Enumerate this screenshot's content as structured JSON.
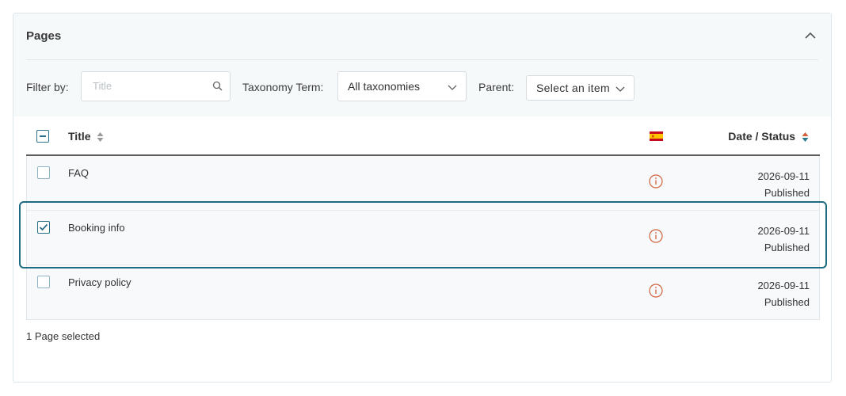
{
  "panel": {
    "title": "Pages"
  },
  "filters": {
    "filter_by_label": "Filter by:",
    "title_placeholder": "Title",
    "taxonomy_label": "Taxonomy Term:",
    "taxonomy_value": "All taxonomies",
    "parent_label": "Parent:",
    "parent_value": "Select an item"
  },
  "table": {
    "col_title": "Title",
    "col_date": "Date / Status",
    "language_flag": "es-flag-icon",
    "rows": [
      {
        "title": "FAQ",
        "date": "2026-09-11",
        "status": "Published",
        "checked": false
      },
      {
        "title": "Booking info",
        "date": "2026-09-11",
        "status": "Published",
        "checked": true
      },
      {
        "title": "Privacy policy",
        "date": "2026-09-11",
        "status": "Published",
        "checked": false
      }
    ]
  },
  "footer": {
    "selection_text": "1 Page selected"
  },
  "colors": {
    "accent": "#1d6b80",
    "warning": "#d2603a",
    "checkbox": "#2a6f8a"
  }
}
